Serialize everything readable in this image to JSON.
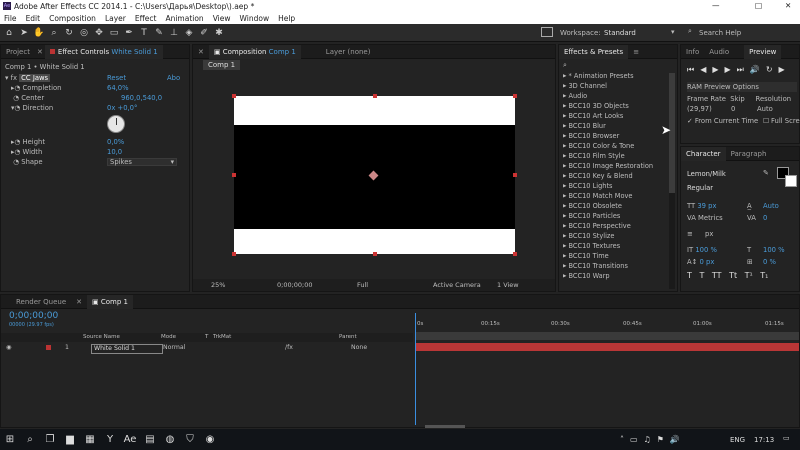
{
  "window": {
    "title": "Adobe After Effects CC 2014.1 - C:\\Users\\Дарья\\Desktop\\).aep *",
    "controls": [
      "—",
      "□",
      "✕"
    ]
  },
  "menu": [
    "File",
    "Edit",
    "Composition",
    "Layer",
    "Effect",
    "Animation",
    "View",
    "Window",
    "Help"
  ],
  "toolbar": {
    "workspace_label": "Workspace:",
    "workspace_value": "Standard",
    "search_placeholder": "Search Help"
  },
  "left_panel": {
    "tabs": [
      "Project",
      "Effect Controls",
      "White Solid 1"
    ],
    "breadcrumb": "Comp 1 • White Solid 1",
    "effect_name": "CC Jaws",
    "reset": "Reset",
    "about": "Abo",
    "props": [
      {
        "name": "Completion",
        "value": "64,0%"
      },
      {
        "name": "Center",
        "value": "960,0,540,0"
      },
      {
        "name": "Direction",
        "value": "0x +0,0°"
      },
      {
        "name": "Height",
        "value": "0,0%"
      },
      {
        "name": "Width",
        "value": "10,0"
      },
      {
        "name": "Shape",
        "value": "Spikes"
      }
    ]
  },
  "comp_panel": {
    "tab": "Composition",
    "tab_name": "Comp 1",
    "layer_tab": "Layer (none)",
    "comp_chip": "Comp 1",
    "zoom": "25%",
    "timecode": "0;00;00;00",
    "resolution": "Full",
    "camera": "Active Camera",
    "views": "1 View"
  },
  "effects_panel": {
    "title": "Effects & Presets",
    "items": [
      "* Animation Presets",
      "3D Channel",
      "Audio",
      "BCC10 3D Objects",
      "BCC10 Art Looks",
      "BCC10 Blur",
      "BCC10 Browser",
      "BCC10 Color & Tone",
      "BCC10 Film Style",
      "BCC10 Image Restoration",
      "BCC10 Key & Blend",
      "BCC10 Lights",
      "BCC10 Match Move",
      "BCC10 Obsolete",
      "BCC10 Particles",
      "BCC10 Perspective",
      "BCC10 Stylize",
      "BCC10 Textures",
      "BCC10 Time",
      "BCC10 Transitions",
      "BCC10 Warp"
    ]
  },
  "preview_panel": {
    "tabs": [
      "Info",
      "Audio",
      "Preview"
    ],
    "ram": "RAM Preview Options",
    "frame_rate_label": "Frame Rate",
    "skip_label": "Skip",
    "resolution_label": "Resolution",
    "frame_rate": "(29,97)",
    "skip": "0",
    "resolution": "Auto",
    "from_current": "From Current Time",
    "full_screen": "Full Screen"
  },
  "character_panel": {
    "tabs": [
      "Character",
      "Paragraph"
    ],
    "font": "Lemon/Milk",
    "style": "Regular",
    "size": "39 px",
    "leading": "Auto",
    "kerning": "Metrics",
    "tracking": "0",
    "stroke": "px",
    "vscale": "100 %",
    "hscale": "100 %",
    "baseline": "0 px",
    "tsume": "0 %",
    "type_buttons": [
      "T",
      "T",
      "TT",
      "Tt",
      "T¹",
      "T₁"
    ]
  },
  "timeline": {
    "tabs": [
      "Render Queue",
      "Comp 1"
    ],
    "timecode": "0;00;00;00",
    "fps": "00000 (29.97 fps)",
    "col_source": "Source Name",
    "col_mode": "Mode",
    "col_t": "T",
    "col_trkmat": "TrkMat",
    "col_parent": "Parent",
    "layer_num": "1",
    "layer_name": "White Solid 1",
    "layer_mode": "Normal",
    "layer_parent": "None",
    "ruler": [
      "0s",
      "00:15s",
      "00:30s",
      "00:45s",
      "01:00s",
      "01:15s"
    ]
  },
  "taskbar": {
    "lang": "ENG",
    "time": "17:13"
  },
  "colors": {
    "accent": "#4a9bd8",
    "layer_bar": "#b93636",
    "playhead": "#3a8ee0"
  }
}
